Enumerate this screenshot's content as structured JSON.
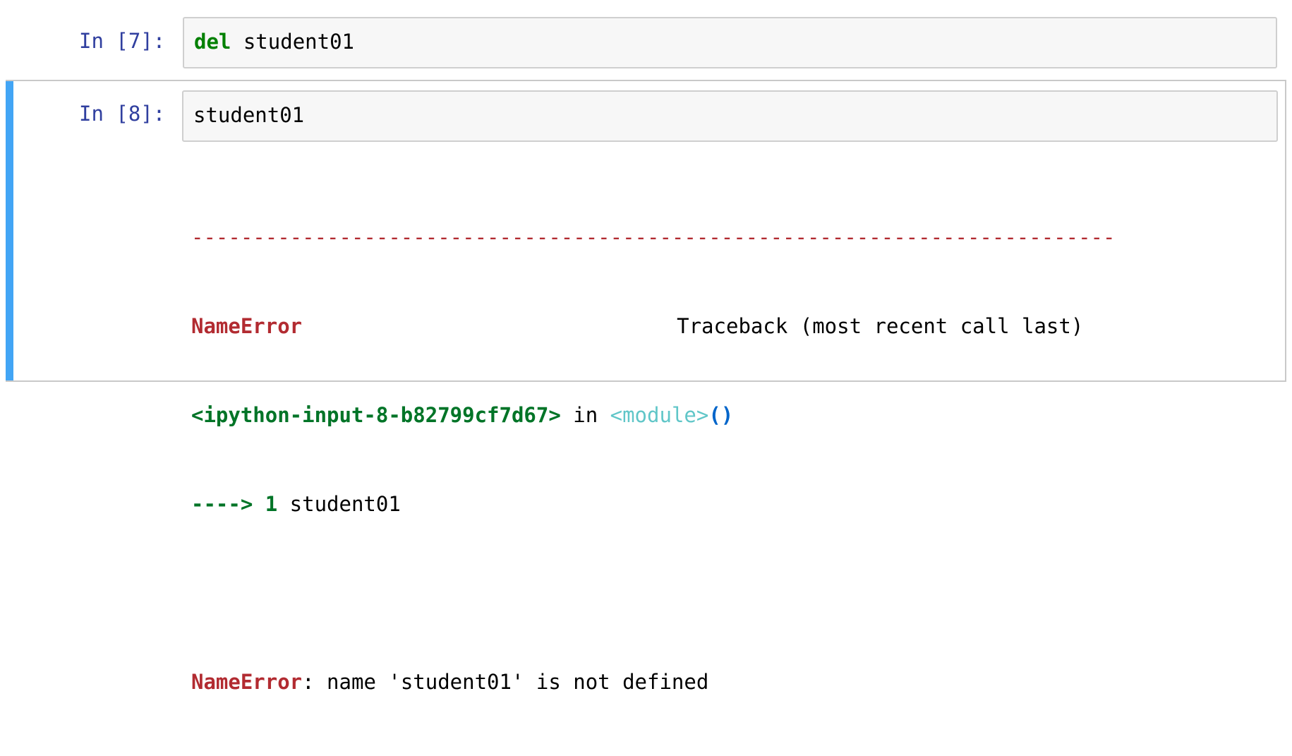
{
  "cells": [
    {
      "prompt": "In [7]:",
      "code_keyword": "del",
      "code_rest": " student01"
    },
    {
      "prompt": "In [8]:",
      "code": "student01",
      "output": {
        "separator": "---------------------------------------------------------------------------",
        "error_name": "NameError",
        "traceback_header": "Traceback (most recent call last)",
        "input_ref": "<ipython-input-8-b82799cf7d67>",
        "in_text": " in ",
        "module_text": "<module>",
        "parens": "()",
        "arrow": "----> 1",
        "arrow_code": " student01",
        "final_error_name": "NameError",
        "final_message": ": name 'student01' is not defined"
      }
    }
  ],
  "colors": {
    "prompt": "#303f9f",
    "keyword": "#008000",
    "error_red": "#b22b31",
    "traceback_green": "#007427",
    "module_cyan": "#60c6c8",
    "parens_blue": "#0065ca",
    "selected_bar": "#42a5f5"
  }
}
